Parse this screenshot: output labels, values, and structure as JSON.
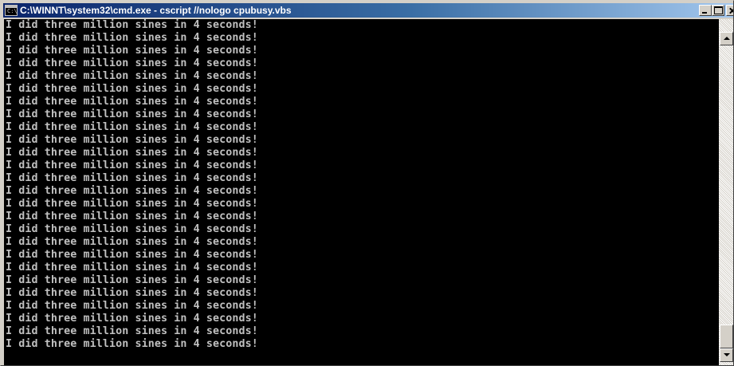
{
  "window": {
    "title": "C:\\WINNT\\system32\\cmd.exe - cscript //nologo cpubusy.vbs",
    "icon": "console-window-icon",
    "icon_glyph": "C:\\"
  },
  "console": {
    "text_color": "#c0c0c0",
    "background_color": "#000000",
    "lines": [
      "I did three million sines in 4 seconds!",
      "I did three million sines in 4 seconds!",
      "I did three million sines in 4 seconds!",
      "I did three million sines in 4 seconds!",
      "I did three million sines in 4 seconds!",
      "I did three million sines in 4 seconds!",
      "I did three million sines in 4 seconds!",
      "I did three million sines in 4 seconds!",
      "I did three million sines in 4 seconds!",
      "I did three million sines in 4 seconds!",
      "I did three million sines in 4 seconds!",
      "I did three million sines in 4 seconds!",
      "I did three million sines in 4 seconds!",
      "I did three million sines in 4 seconds!",
      "I did three million sines in 4 seconds!",
      "I did three million sines in 4 seconds!",
      "I did three million sines in 4 seconds!",
      "I did three million sines in 4 seconds!",
      "I did three million sines in 4 seconds!",
      "I did three million sines in 4 seconds!",
      "I did three million sines in 4 seconds!",
      "I did three million sines in 4 seconds!",
      "I did three million sines in 4 seconds!",
      "I did three million sines in 4 seconds!",
      "I did three million sines in 4 seconds!",
      "I did three million sines in 4 seconds!"
    ]
  },
  "caption_buttons": {
    "minimize_icon": "minimize-icon",
    "maximize_icon": "maximize-icon",
    "close_icon": "close-icon"
  },
  "scrollbar": {
    "up_icon": "scroll-up-arrow-icon",
    "down_icon": "scroll-down-arrow-icon",
    "scroll_position": 0.95
  },
  "colors": {
    "title_active_start": "#0a246a",
    "title_active_end": "#a6caf0",
    "chrome": "#d4d0c8"
  }
}
